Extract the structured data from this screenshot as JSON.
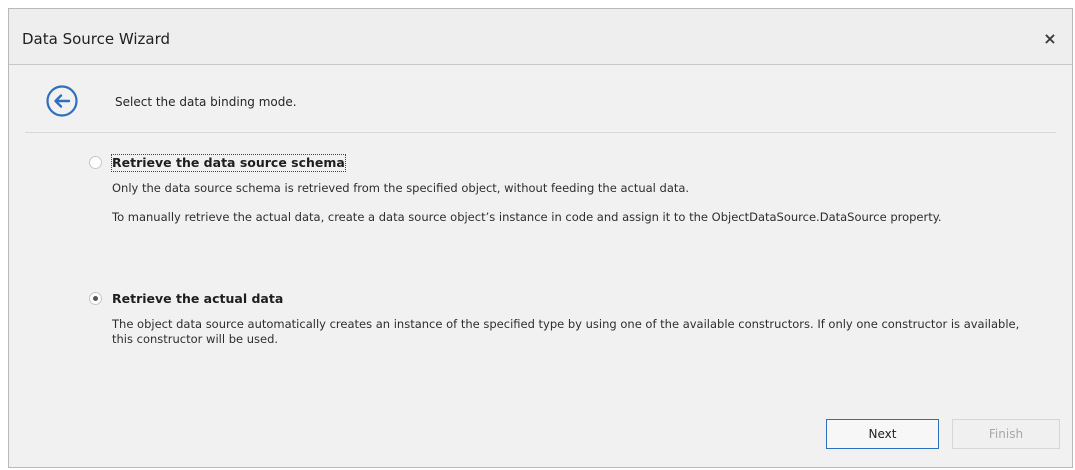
{
  "window": {
    "title": "Data Source Wizard",
    "close_glyph": "×"
  },
  "header": {
    "back_icon": "circle-arrow-left-icon",
    "subtitle": "Select the data binding mode."
  },
  "options": [
    {
      "label": "Retrieve the data source schema",
      "selected": false,
      "descriptions": [
        "Only the data source schema is retrieved from the specified object, without feeding the actual data.",
        "To manually retrieve the actual data, create a data source object’s instance in code and assign it to the ObjectDataSource.DataSource property."
      ]
    },
    {
      "label": "Retrieve the actual data",
      "selected": true,
      "descriptions": [
        "The object data source automatically creates an instance of the specified type by using one of the available constructors. If only one constructor is available, this constructor will be used."
      ]
    }
  ],
  "footer": {
    "next_label": "Next",
    "finish_label": "Finish"
  },
  "colors": {
    "accent": "#2f6fbf",
    "window_bg": "#f1f1f1",
    "disabled_text": "#a8a8a8"
  }
}
